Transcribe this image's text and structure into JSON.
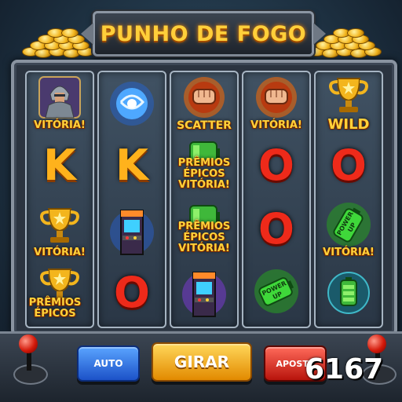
{
  "title": "PUNHO DE FOGO",
  "reels": [
    {
      "cells": [
        {
          "symbol": "armored-warrior",
          "label": "VITÓRIA!"
        },
        {
          "symbol": "letter",
          "letter": "K",
          "color": "gold"
        },
        {
          "symbol": "gold-trophy",
          "label": "VITÓRIA!"
        },
        {
          "symbol": "gold-trophy",
          "label": "PRÊMIOS ÉPICOS"
        }
      ]
    },
    {
      "cells": [
        {
          "symbol": "blue-energy-orb"
        },
        {
          "symbol": "letter",
          "letter": "K",
          "color": "gold"
        },
        {
          "symbol": "arcade-cabinet"
        },
        {
          "symbol": "letter",
          "letter": "O",
          "color": "red"
        }
      ]
    },
    {
      "cells": [
        {
          "symbol": "fire-fist",
          "label": "SCATTER"
        },
        {
          "symbol": "green-battery",
          "label": "PRÊMIOS ÉPICOS VITÓRIA!"
        },
        {
          "symbol": "green-battery",
          "label": "PRÊMIOS ÉPICOS VITÓRIA!"
        },
        {
          "symbol": "arcade-cabinet"
        }
      ]
    },
    {
      "cells": [
        {
          "symbol": "fire-fist",
          "label": "VITÓRIA!"
        },
        {
          "symbol": "letter",
          "letter": "O",
          "color": "red"
        },
        {
          "symbol": "letter",
          "letter": "O",
          "color": "red"
        },
        {
          "symbol": "power-up-battery",
          "art_text": "POWER UP"
        }
      ]
    },
    {
      "cells": [
        {
          "symbol": "gold-trophy",
          "label": "WILD"
        },
        {
          "symbol": "letter",
          "letter": "O",
          "color": "red"
        },
        {
          "symbol": "power-up-battery",
          "label": "VITÓRIA!",
          "art_text": "POWER UP"
        },
        {
          "symbol": "green-battery"
        }
      ]
    }
  ],
  "controls": {
    "auto_label": "AUTO",
    "spin_label": "GIRAR",
    "bet_label": "APOSTA"
  },
  "counter": "6167",
  "colors": {
    "title_gold": "#ffcf3a",
    "label_gold": "#ffd23a",
    "letter_gold": "#ffb21c",
    "letter_red": "#ee2a1a",
    "auto_blue": "#1c52c8",
    "spin_orange": "#e28a00",
    "bet_red": "#b8140c"
  }
}
